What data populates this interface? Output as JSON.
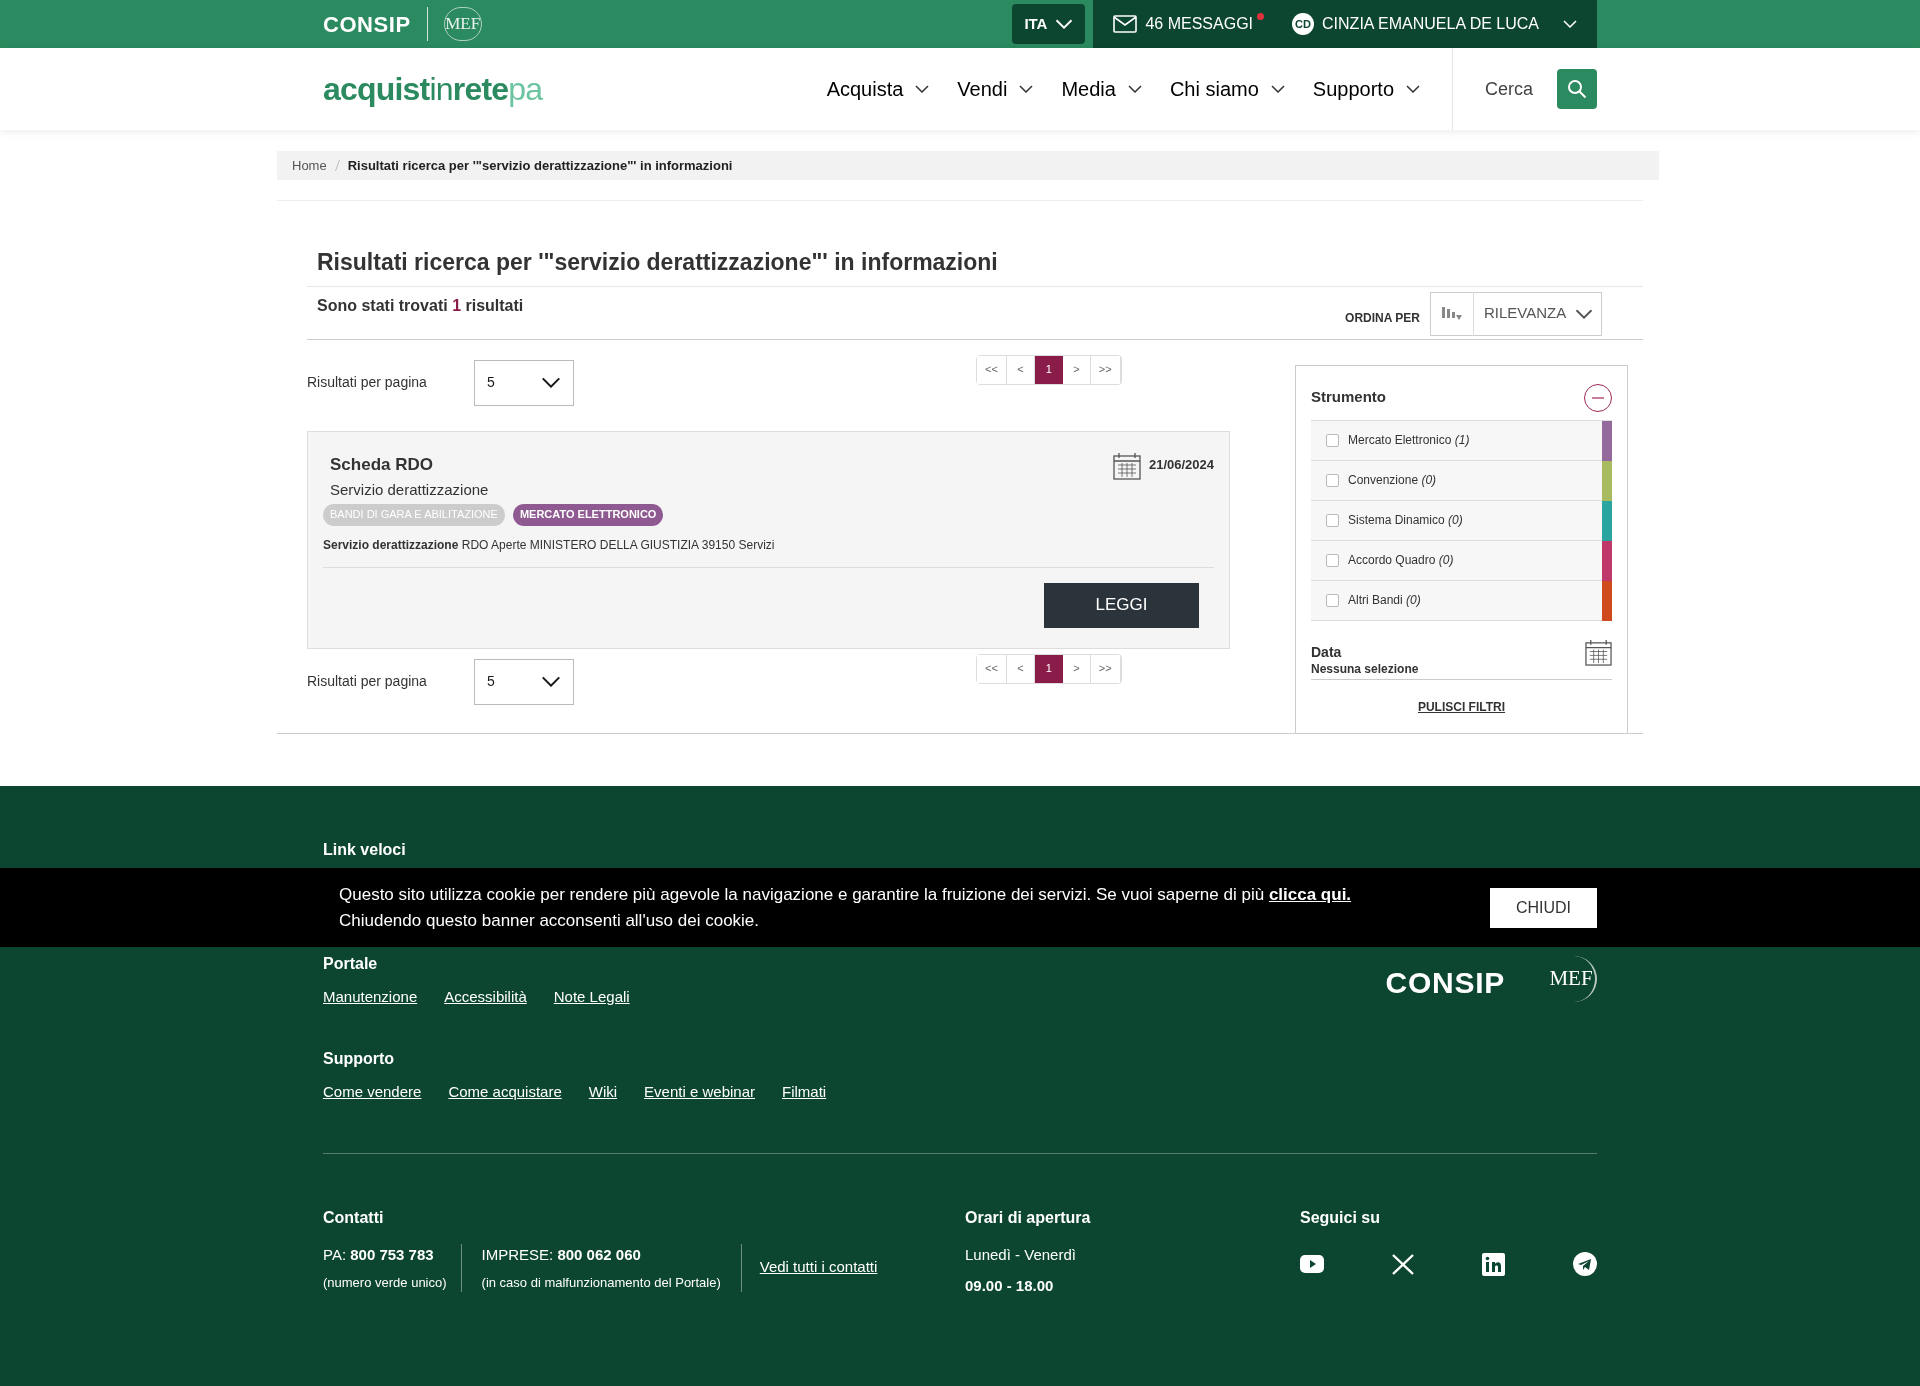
{
  "topbar": {
    "consip_logo": "CONSIP",
    "mef_logo": "MEF",
    "language": "ITA",
    "messages": "46 MESSAGGI",
    "has_unread": true,
    "user_initials": "CD",
    "user_name": "CINZIA EMANUELA DE LUCA"
  },
  "header": {
    "logo": [
      "acquist",
      "in",
      "rete",
      "pa"
    ],
    "menu": [
      {
        "label": "Acquista"
      },
      {
        "label": "Vendi"
      },
      {
        "label": "Media"
      },
      {
        "label": "Chi siamo"
      },
      {
        "label": "Supporto"
      }
    ],
    "search": {
      "placeholder": "Cerca"
    }
  },
  "breadcrumb": [
    "Home",
    "Risultati ricerca per '\"servizio derattizzazione\"' in informazioni"
  ],
  "title": "Risultati ricerca per '\"servizio derattizzazione\"' in informazioni",
  "results_count": {
    "prefix": "Sono stati trovati",
    "count": "1",
    "suffix": "risultati"
  },
  "sort": {
    "label": "ORDINA PER",
    "value": "RILEVANZA"
  },
  "per_page_top": {
    "label": "Risultati per pagina",
    "value": "5"
  },
  "pagination_top": [
    {
      "label": "<<",
      "selected": false
    },
    {
      "label": "<",
      "selected": false
    },
    {
      "label": "1",
      "selected": true
    },
    {
      "label": ">",
      "selected": false
    },
    {
      "label": ">>",
      "selected": false
    }
  ],
  "result": {
    "title": "Scheda RDO",
    "subtitle": "Servizio derattizzazione",
    "date": "21/06/2024",
    "tags": [
      {
        "label": "BANDI DI GARA E ABILITAZIONE",
        "color": "#cccccc"
      },
      {
        "label": "MERCATO ELETTRONICO",
        "color": "#8e5a91"
      }
    ],
    "description": "**Servizio derattizzazione** RDO Aperte MINISTERO DELLA GIUSTIZIA 39150 Servizi",
    "button": "LEGGI"
  },
  "per_page_bottom": {
    "label": "Risultati per pagina",
    "value": "5"
  },
  "pagination_bottom": [
    {
      "label": "<<",
      "selected": false
    },
    {
      "label": "<",
      "selected": false
    },
    {
      "label": "1",
      "selected": true
    },
    {
      "label": ">",
      "selected": false
    },
    {
      "label": ">>",
      "selected": false
    }
  ],
  "filters": {
    "title": "Strumento",
    "expanded": true,
    "items": [
      {
        "label": "Mercato Elettronico",
        "count": "(1)",
        "checked": false,
        "color": "#946a9c"
      },
      {
        "label": "Convenzione",
        "count": "(0)",
        "checked": false,
        "color": "#a9bb61"
      },
      {
        "label": "Sistema Dinamico",
        "count": "(0)",
        "checked": false,
        "color": "#2aa5a0"
      },
      {
        "label": "Accordo Quadro",
        "count": "(0)",
        "checked": false,
        "color": "#c0376a"
      },
      {
        "label": "Altri Bandi",
        "count": "(0)",
        "checked": false,
        "color": "#cf4a1c"
      }
    ],
    "date_title": "Data",
    "date_value": "Nessuna selezione",
    "clear": "PULISCI FILTRI"
  },
  "footer": {
    "quick_links_title": "Link veloci",
    "sections": [
      {
        "title": "Portale",
        "links": [
          "Manutenzione",
          "Accessibilità",
          "Note Legali"
        ]
      },
      {
        "title": "Supporto",
        "links": [
          "Come vendere",
          "Come acquistare",
          "Wiki",
          "Eventi e webinar",
          "Filmati"
        ]
      }
    ],
    "logos": [
      "CONSIP",
      "MEF"
    ],
    "contacts": {
      "title": "Contatti",
      "pa_label": "PA:",
      "pa_number": "800 753 783",
      "pa_note": "(numero verde unico)",
      "imprese_label": "IMPRESE:",
      "imprese_number": "800 062 060",
      "imprese_note": "(in caso di malfunzionamento del Portale)",
      "all_link": "Vedi tutti i contatti"
    },
    "hours": {
      "title": "Orari di apertura",
      "days": "Lunedì - Venerdì",
      "time": "09.00 - 18.00"
    },
    "social": {
      "title": "Seguici su",
      "networks": [
        {
          "kind": "youtube"
        },
        {
          "kind": "x"
        },
        {
          "kind": "linkedin"
        },
        {
          "kind": "telegram"
        }
      ]
    }
  },
  "cookie_banner": {
    "text": "Questo sito utilizza cookie per rendere più agevole la navigazione e garantire la fruizione dei servizi. Se vuoi saperne di più",
    "link": "clicca qui.",
    "line2": "Chiudendo questo banner acconsenti all'uso dei cookie.",
    "button": "CHIUDI"
  }
}
